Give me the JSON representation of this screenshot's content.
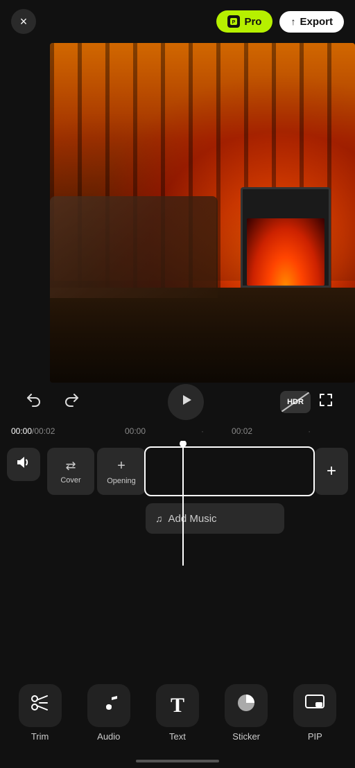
{
  "topBar": {
    "close_label": "×",
    "pro_label": "Pro",
    "export_label": "Export",
    "export_icon": "↑"
  },
  "controls": {
    "undo_icon": "↩",
    "redo_icon": "↪",
    "play_icon": "▶",
    "hdr_label": "HDR",
    "fullscreen_icon": "⛶"
  },
  "timeline": {
    "current_time": "00:00",
    "total_time": "00:02",
    "mark1": "00:00",
    "mark2": "00:02"
  },
  "tracks": {
    "audio_icon": "🔊",
    "cover_label": "Cover",
    "cover_icon": "⇄",
    "opening_label": "Opening",
    "opening_icon": "+",
    "add_clip_icon": "+",
    "add_music_label": "Add Music",
    "music_icon": "♫"
  },
  "toolbar": {
    "items": [
      {
        "id": "trim",
        "label": "Trim",
        "icon": "✂"
      },
      {
        "id": "audio",
        "label": "Audio",
        "icon": "♪"
      },
      {
        "id": "text",
        "label": "Text",
        "icon": "T"
      },
      {
        "id": "sticker",
        "label": "Sticker",
        "icon": "●"
      },
      {
        "id": "pip",
        "label": "PIP",
        "icon": "⊞"
      }
    ]
  }
}
